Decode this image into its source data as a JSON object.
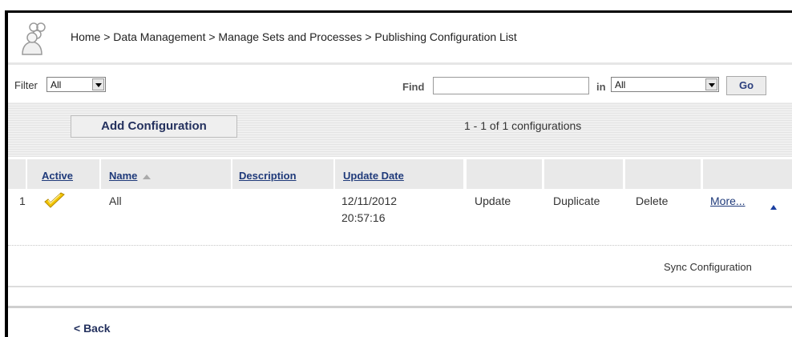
{
  "breadcrumb": {
    "text": "Home > Data Management > Manage Sets and Processes > Publishing Configuration List"
  },
  "filter": {
    "label": "Filter",
    "value": "All",
    "find_label": "Find",
    "find_value": "",
    "in_label": "in",
    "in_value": "All",
    "go_label": "Go"
  },
  "toolbar": {
    "add_label": "Add Configuration",
    "count_text": "1 - 1 of 1 configurations"
  },
  "table": {
    "columns": [
      "Active",
      "Name",
      "Description",
      "Update Date"
    ],
    "rows": [
      {
        "index": "1",
        "name": "All",
        "description": "",
        "update_date": "12/11/2012",
        "update_time": "20:57:16",
        "actions": [
          "Update",
          "Duplicate",
          "Delete",
          "More..."
        ]
      }
    ]
  },
  "footer": {
    "sync_label": "Sync Configuration",
    "back_label": "< Back"
  },
  "colors": {
    "link": "#1f3a7a",
    "header_bg": "#e9e9e9",
    "check": "#f2c400"
  }
}
